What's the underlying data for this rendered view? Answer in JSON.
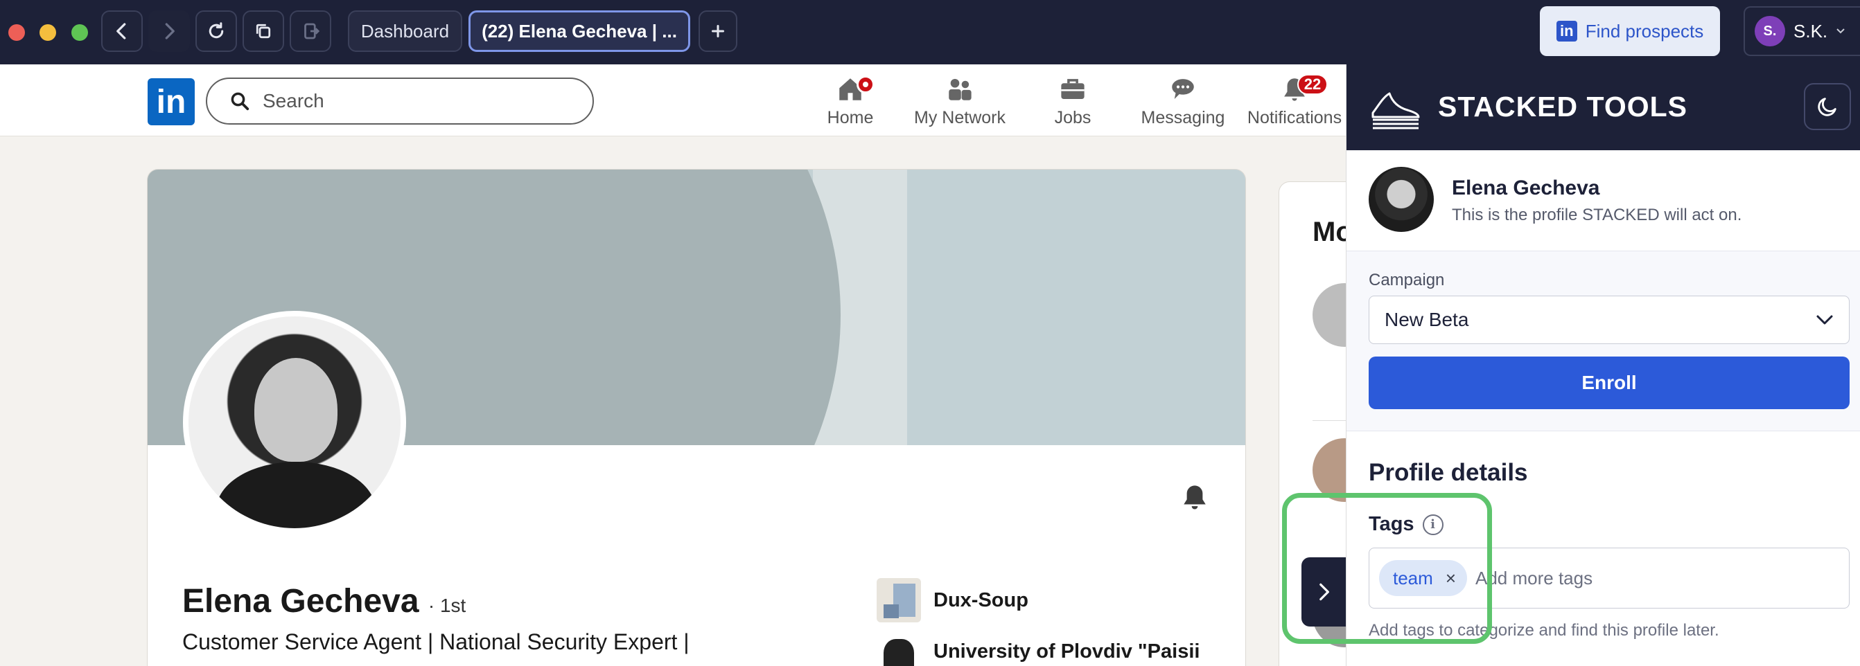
{
  "browser": {
    "tabs": [
      {
        "label": "Dashboard"
      },
      {
        "label": "(22) Elena Gecheva | ..."
      }
    ],
    "find_prospects_label": "Find prospects",
    "user_initial": "S.",
    "user_name": "S.K."
  },
  "linkedin": {
    "logo": "in",
    "search_placeholder": "Search",
    "nav": [
      {
        "label": "Home",
        "icon": "home-icon"
      },
      {
        "label": "My Network",
        "icon": "network-icon"
      },
      {
        "label": "Jobs",
        "icon": "briefcase-icon"
      },
      {
        "label": "Messaging",
        "icon": "messaging-icon"
      },
      {
        "label": "Notifications",
        "icon": "bell-icon",
        "badge": "22"
      }
    ],
    "profile": {
      "name": "Elena Gecheva",
      "degree": "· 1st",
      "headline": "Customer Service Agent | National Security Expert |"
    },
    "experience": [
      {
        "name": "Dux-Soup"
      },
      {
        "name": "University of Plovdiv \"Paisii"
      }
    ],
    "side_card_title": "Mo"
  },
  "stacked": {
    "title": "STACKED TOOLS",
    "profile_name": "Elena Gecheva",
    "profile_sub": "This is the profile STACKED will act on.",
    "campaign_label": "Campaign",
    "campaign_value": "New Beta",
    "enroll_label": "Enroll",
    "details_title": "Profile details",
    "tags_label": "Tags",
    "tags": [
      "team"
    ],
    "tag_placeholder": "Add more tags",
    "tags_hint": "Add tags to categorize and find this profile later."
  },
  "colors": {
    "chrome_bg": "#1d2138",
    "linkedin_blue": "#0a66c2",
    "accent_blue": "#2c5ad9",
    "highlight_green": "#5ec46d"
  }
}
